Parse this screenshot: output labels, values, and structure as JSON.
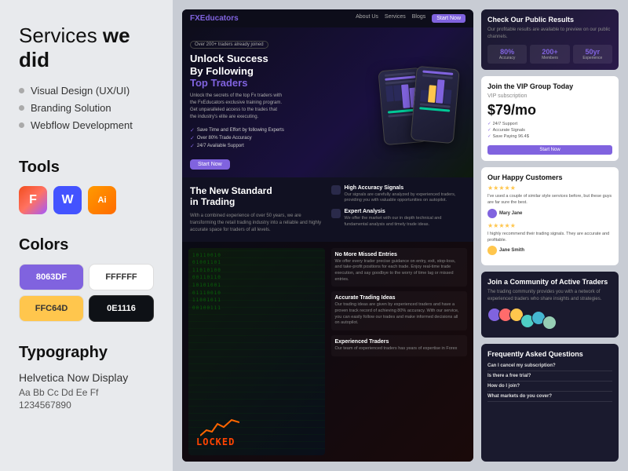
{
  "left": {
    "heading_normal": "Services ",
    "heading_bold": "we did",
    "services": [
      "Visual Design (UX/UI)",
      "Branding Solution",
      "Webflow Development"
    ],
    "tools_title": "Tools",
    "tools": [
      {
        "name": "figma",
        "label": "F"
      },
      {
        "name": "webflow",
        "label": "W"
      },
      {
        "name": "illustrator",
        "label": "Ai"
      }
    ],
    "colors_title": "Colors",
    "colors": [
      {
        "hex": "#8063DF",
        "label": "8063DF",
        "dark": true
      },
      {
        "hex": "#FFFFFF",
        "label": "FFFFFF",
        "dark": false
      },
      {
        "hex": "#FFC64D",
        "label": "FFC64D",
        "dark": false
      },
      {
        "hex": "#0E1116",
        "label": "0E1116",
        "dark": true
      }
    ],
    "typography_title": "Typography",
    "font_name": "Helvetica Now Display",
    "font_sample": "Aa Bb Cc Dd Ee Ff",
    "font_numbers": "1234567890"
  },
  "site": {
    "nav": {
      "logo": "FX",
      "logo2": "Educators",
      "links": [
        "About Us",
        "Services",
        "Blogs"
      ],
      "cta": "Start Now"
    },
    "hero": {
      "badge": "Over 200+ traders already joined",
      "title_line1": "Unlock Success",
      "title_line2": "By Following",
      "title_accent": "Top Traders",
      "description": "Unlock the secrets of the top Fx traders with the FxEducators exclusive training program. Get unparalleled access to the trades that the industry's elite are executing.",
      "features": [
        "Save Time and Effort by following Experts",
        "Over 80% Trade Accuracy",
        "24/7 Available Support"
      ],
      "cta": "Start Now"
    },
    "trading": {
      "title_line1": "The New Standard",
      "title_line2": "in Trading",
      "desc": "With a combined experience of over 50 years, we are transforming the retail trading industry into a reliable and highly accurate space for traders of all levels.",
      "features": [
        {
          "title": "High Accuracy Signals",
          "desc": "Our signals are carefully analyzed by experienced traders, providing you with valuable opportunities on autopilot."
        },
        {
          "title": "Expert Analysis",
          "desc": "We offer the market with our in depth technical and fundamental analysis and timely trade ideas."
        }
      ]
    },
    "missed": {
      "features": [
        {
          "title": "No More Missed Entries",
          "desc": "We offer every trader precise guidance on entry, exit, stop-loss, and take-profit positions for each trade. Enjoy real-time trade execution, and say goodbye to the worry of time lag or missed entries."
        },
        {
          "title": "Accurate Trading Ideas",
          "desc": "Our trading ideas are given by experienced traders and have a proven track record of achieving 80% accuracy. With our service, you can easily follow our trades and make informed decisions all on autopilot."
        },
        {
          "title": "Experienced Traders",
          "desc": "Our team of experienced traders has years of expertise in Forex"
        }
      ]
    }
  },
  "right_sidebar": {
    "check_results": {
      "title": "Check Our Public Results",
      "desc": "Our profitable results are available to preview on our public channels.",
      "stats": [
        {
          "value": "80%",
          "label": "Accuracy"
        },
        {
          "value": "200+",
          "label": "Members"
        },
        {
          "value": "50yr",
          "label": "Experience"
        }
      ]
    },
    "vip": {
      "title": "Join the VIP Group Today",
      "label": "VIP subscription",
      "price": "$79/mo",
      "features": [
        "24/7 Support",
        "Accurate Signals",
        "Save Paying 96.4$"
      ],
      "cta": "Start Now"
    },
    "customers": {
      "title": "Our Happy Customers",
      "reviews": [
        {
          "stars": 5,
          "text": "I've used a couple of similar style services before, but these guys are far sure the best.",
          "name": "Mary Jane"
        },
        {
          "stars": 5,
          "text": "I highly recommend their trading signals. They are accurate and profitable.",
          "name": "Jane Smith"
        }
      ]
    },
    "community": {
      "title": "Join a Community of Active Traders",
      "desc": "The trading community provides you with a network of experienced traders who share insights and strategies.",
      "avatar_colors": [
        "#8063df",
        "#ff6b6b",
        "#ffc64d",
        "#4ecdc4",
        "#45b7d1",
        "#96ceb4"
      ]
    },
    "faq": {
      "title": "Frequently Asked Questions",
      "items": [
        {
          "q": "Can I cancel my subscription?"
        },
        {
          "q": "Is there a free trial?"
        },
        {
          "q": "How do I join?"
        },
        {
          "q": "What markets do you cover?"
        }
      ]
    }
  }
}
